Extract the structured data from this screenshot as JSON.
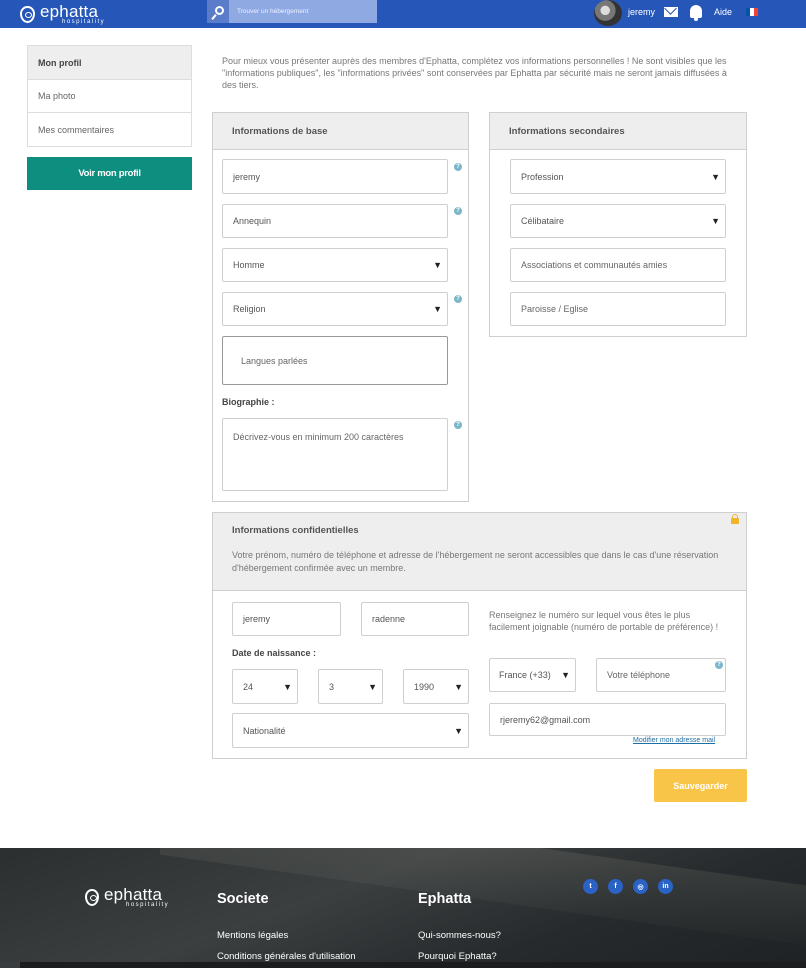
{
  "header": {
    "logo_name": "ephatta",
    "logo_sub": "hospitality",
    "search_placeholder": "Trouver un hébergement",
    "user_name": "jeremy",
    "help_label": "Aide",
    "flag_colors": [
      "#0055a4",
      "#ffffff",
      "#ef4135"
    ]
  },
  "sidebar": {
    "items": [
      {
        "label": "Mon profil"
      },
      {
        "label": "Ma photo"
      },
      {
        "label": "Mes commentaires"
      }
    ],
    "view_profile_label": "Voir mon profil"
  },
  "intro_text": "Pour mieux vous présenter auprès des membres d'Ephatta, complétez vos informations personnelles ! Ne sont visibles que les \"informations publiques\", les \"informations privées\" sont conservées par Ephatta par sécurité mais ne seront jamais diffusées à des tiers.",
  "basic_info": {
    "title": "Informations de base",
    "first_name": "jeremy",
    "last_name": "Annequin",
    "gender": "Homme",
    "religion": "Religion",
    "languages_placeholder": "Langues parlées",
    "bio_label": "Biographie :",
    "bio_placeholder": "Décrivez-vous en minimum 200 caractères",
    "help_glyph": "?"
  },
  "secondary_info": {
    "title": "Informations secondaires",
    "profession": "Profession",
    "marital_status": "Célibataire",
    "associations_placeholder": "Associations et communautés amies",
    "parish_placeholder": "Paroisse / Eglise"
  },
  "confidential_info": {
    "title": "Informations confidentielles",
    "description": "Votre prénom, numéro de téléphone et adresse de l'hébergement ne seront accessibles que dans le cas d'une réservation d'hébergement confirmée avec un membre.",
    "first_name": "jeremy",
    "last_name": "radenne",
    "birth_label": "Date de naissance :",
    "birth_day": "24",
    "birth_month": "3",
    "birth_year": "1990",
    "nationality": "Nationalité",
    "phone_hint": "Renseignez le numéro sur lequel vous êtes le plus facilement joignable (numéro de portable de préférence) !",
    "country_code": "France (+33)",
    "phone_placeholder": "Votre téléphone",
    "email": "rjeremy62@gmail.com",
    "modify_email_label": "Modifier mon adresse mail"
  },
  "save_label": "Sauvegarder",
  "footer": {
    "logo_name": "ephatta",
    "logo_sub": "hospitality",
    "col1_title": "Societe",
    "col1_links": [
      "Mentions légales",
      "Conditions générales d'utilisation"
    ],
    "col2_title": "Ephatta",
    "col2_links": [
      "Qui-sommes-nous?",
      "Pourquoi Ephatta?"
    ],
    "social": [
      "t",
      "f",
      "◎",
      "in"
    ]
  }
}
